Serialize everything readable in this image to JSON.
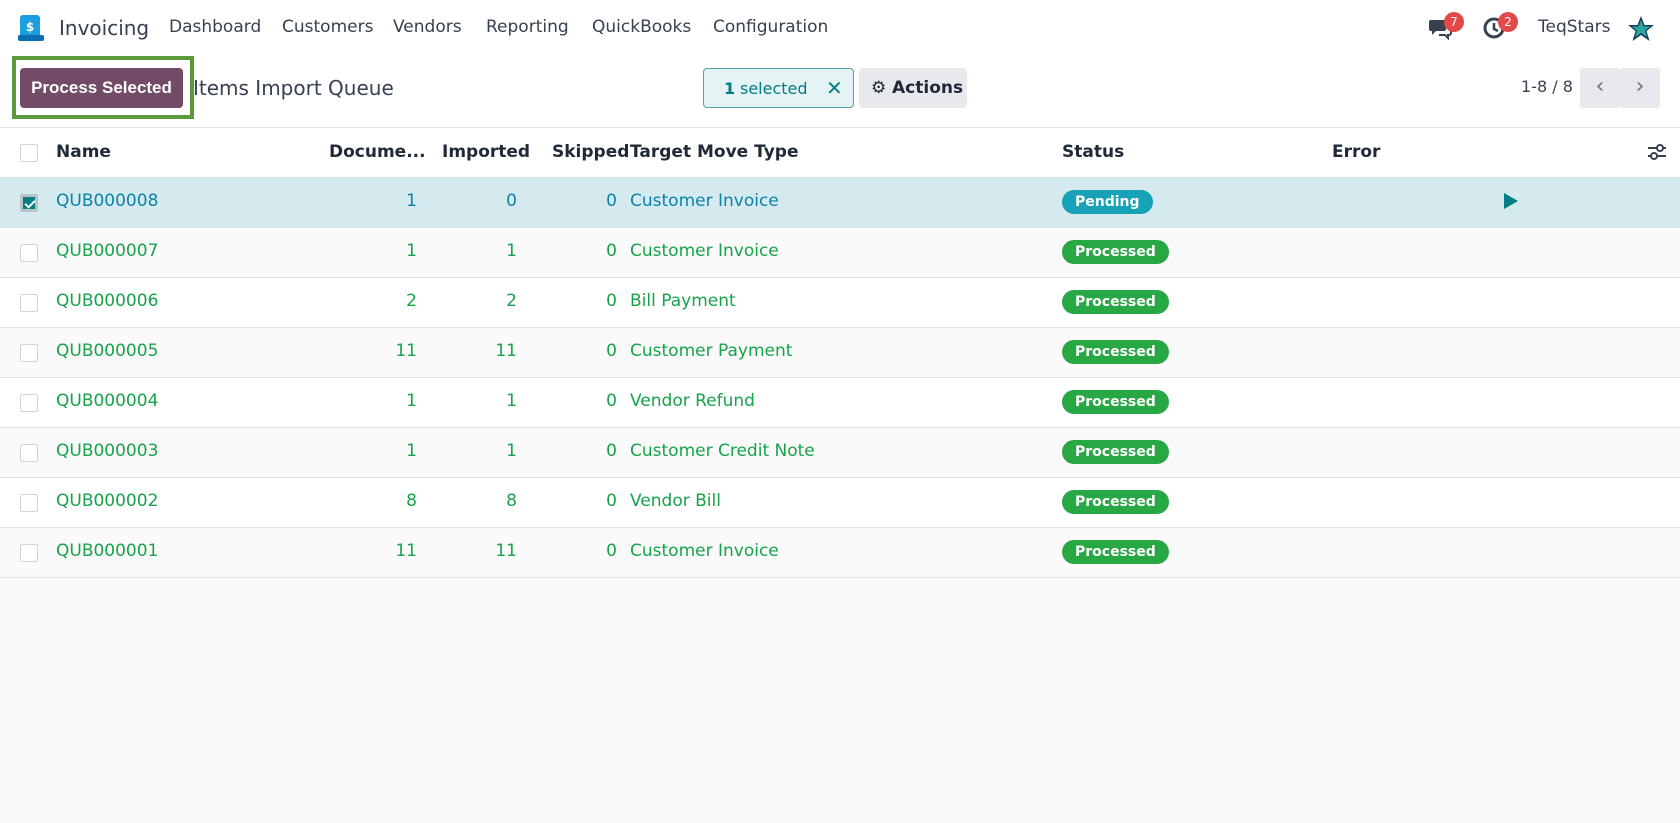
{
  "nav": {
    "app_name": "Invoicing",
    "items": [
      "Dashboard",
      "Customers",
      "Vendors",
      "Reporting",
      "QuickBooks",
      "Configuration"
    ],
    "messages_count": "7",
    "activities_count": "2",
    "user": "TeqStars"
  },
  "control": {
    "process_button": "Process Selected",
    "title": "Items Import Queue",
    "selected_count": "1",
    "selected_label": "selected",
    "clear_icon": "✕",
    "actions_label": "Actions",
    "pager": "1-8 / 8"
  },
  "table": {
    "headers": [
      "Name",
      "Docume...",
      "Imported",
      "Skipped",
      "Target Move Type",
      "Status",
      "Error"
    ],
    "rows": [
      {
        "name": "QUB000008",
        "documents": "1",
        "imported": "0",
        "skipped": "0",
        "type": "Customer Invoice",
        "status": "Pending"
      },
      {
        "name": "QUB000007",
        "documents": "1",
        "imported": "1",
        "skipped": "0",
        "type": "Customer Invoice",
        "status": "Processed"
      },
      {
        "name": "QUB000006",
        "documents": "2",
        "imported": "2",
        "skipped": "0",
        "type": "Bill Payment",
        "status": "Processed"
      },
      {
        "name": "QUB000005",
        "documents": "11",
        "imported": "11",
        "skipped": "0",
        "type": "Customer Payment",
        "status": "Processed"
      },
      {
        "name": "QUB000004",
        "documents": "1",
        "imported": "1",
        "skipped": "0",
        "type": "Vendor Refund",
        "status": "Processed"
      },
      {
        "name": "QUB000003",
        "documents": "1",
        "imported": "1",
        "skipped": "0",
        "type": "Customer Credit Note",
        "status": "Processed"
      },
      {
        "name": "QUB000002",
        "documents": "8",
        "imported": "8",
        "skipped": "0",
        "type": "Vendor Bill",
        "status": "Processed"
      },
      {
        "name": "QUB000001",
        "documents": "11",
        "imported": "11",
        "skipped": "0",
        "type": "Customer Invoice",
        "status": "Processed"
      }
    ]
  },
  "colors": {
    "brand": "#714b67",
    "selected_row": "#d4eaee",
    "processed": "#28a745",
    "pending": "#17a2b8",
    "highlight": "#5a9a3d"
  }
}
